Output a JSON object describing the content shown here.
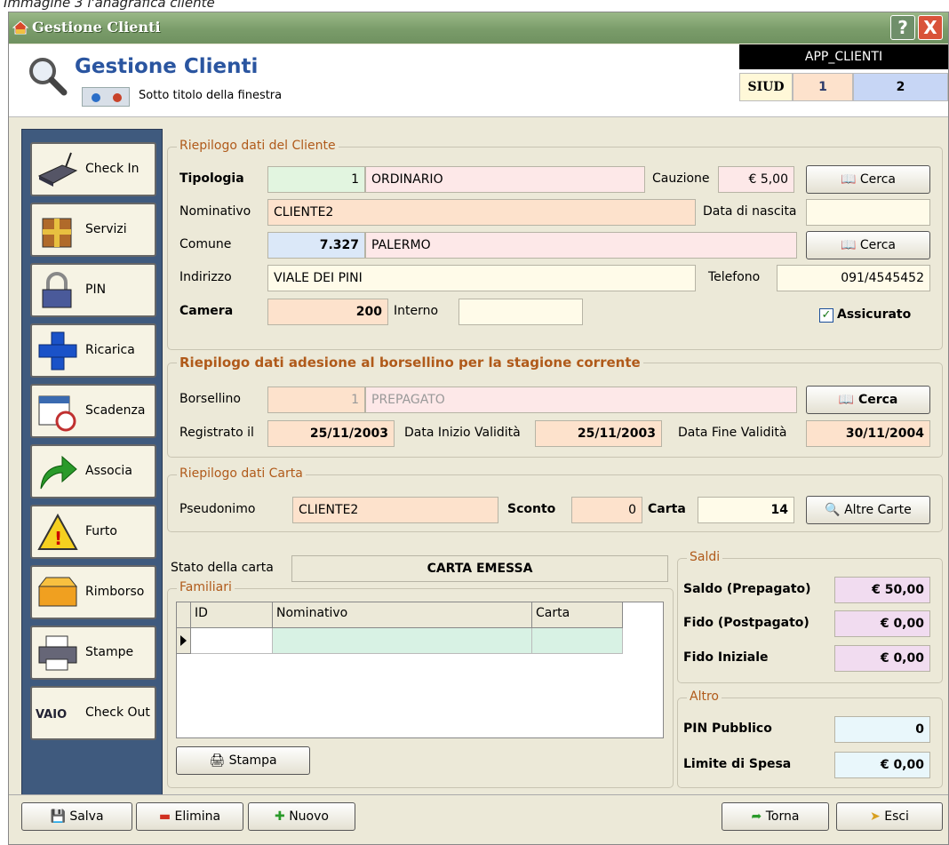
{
  "caption": "Immagine 3 l'anagrafica cliente",
  "window": {
    "title": "Gestione Clienti",
    "help": "?",
    "close": "X"
  },
  "header": {
    "title": "Gestione Clienti",
    "subtitle": "Sotto titolo della finestra",
    "app_code": "APP_CLIENTI",
    "siud": "SIUD",
    "val1": "1",
    "val2": "2"
  },
  "sidebar": [
    {
      "label": "Check In",
      "icon": "modem-icon"
    },
    {
      "label": "Servizi",
      "icon": "gift-icon"
    },
    {
      "label": "PIN",
      "icon": "padlock-icon"
    },
    {
      "label": "Ricarica",
      "icon": "plus-icon"
    },
    {
      "label": "Scadenza",
      "icon": "calendar-clock-icon"
    },
    {
      "label": "Associa",
      "icon": "green-arrow-icon"
    },
    {
      "label": "Furto",
      "icon": "warning-icon"
    },
    {
      "label": "Rimborso",
      "icon": "cash-box-icon"
    },
    {
      "label": "Stampe",
      "icon": "printer-icon"
    },
    {
      "label": "Check Out",
      "icon": "vaio-logo-icon"
    }
  ],
  "cliente": {
    "legend": "Riepilogo dati del Cliente",
    "tipologia_label": "Tipologia",
    "tipologia_code": "1",
    "tipologia_value": "ORDINARIO",
    "cauzione_label": "Cauzione",
    "cauzione_value": "€ 5,00",
    "cerca": "Cerca",
    "nominativo_label": "Nominativo",
    "nominativo_value": "CLIENTE2",
    "nascita_label": "Data di nascita",
    "nascita_value": "",
    "comune_label": "Comune",
    "comune_code": "7.327",
    "comune_value": "PALERMO",
    "indirizzo_label": "Indirizzo",
    "indirizzo_value": "VIALE DEI PINI",
    "telefono_label": "Telefono",
    "telefono_value": "091/4545452",
    "camera_label": "Camera",
    "camera_value": "200",
    "interno_label": "Interno",
    "interno_value": "",
    "assicurato_label": "Assicurato"
  },
  "borsellino": {
    "legend": "Riepilogo dati adesione al borsellino per la stagione corrente",
    "borsellino_label": "Borsellino",
    "borsellino_code": "1",
    "borsellino_value": "PREPAGATO",
    "cerca": "Cerca",
    "registrato_label": "Registrato il",
    "registrato_value": "25/11/2003",
    "inizio_label": "Data Inizio Validità",
    "inizio_value": "25/11/2003",
    "fine_label": "Data Fine Validità",
    "fine_value": "30/11/2004"
  },
  "carta": {
    "legend": "Riepilogo dati Carta",
    "pseudonimo_label": "Pseudonimo",
    "pseudonimo_value": "CLIENTE2",
    "sconto_label": "Sconto",
    "sconto_value": "0",
    "carta_label": "Carta",
    "carta_value": "14",
    "altre": "Altre Carte"
  },
  "stato": {
    "label": "Stato della carta",
    "value": "CARTA EMESSA"
  },
  "familiari": {
    "legend": "Familiari",
    "columns": [
      "ID",
      "Nominativo",
      "Carta"
    ],
    "stampa": "Stampa"
  },
  "saldi": {
    "legend": "Saldi",
    "saldo_label": "Saldo (Prepagato)",
    "saldo_value": "€ 50,00",
    "fido_label": "Fido (Postpagato)",
    "fido_value": "€ 0,00",
    "fido_iniziale_label": "Fido Iniziale",
    "fido_iniziale_value": "€ 0,00"
  },
  "altro": {
    "legend": "Altro",
    "pin_label": "PIN Pubblico",
    "pin_value": "0",
    "limite_label": "Limite di Spesa",
    "limite_value": "€ 0,00"
  },
  "footer": {
    "salva": "Salva",
    "elimina": "Elimina",
    "nuovo": "Nuovo",
    "torna": "Torna",
    "esci": "Esci"
  }
}
